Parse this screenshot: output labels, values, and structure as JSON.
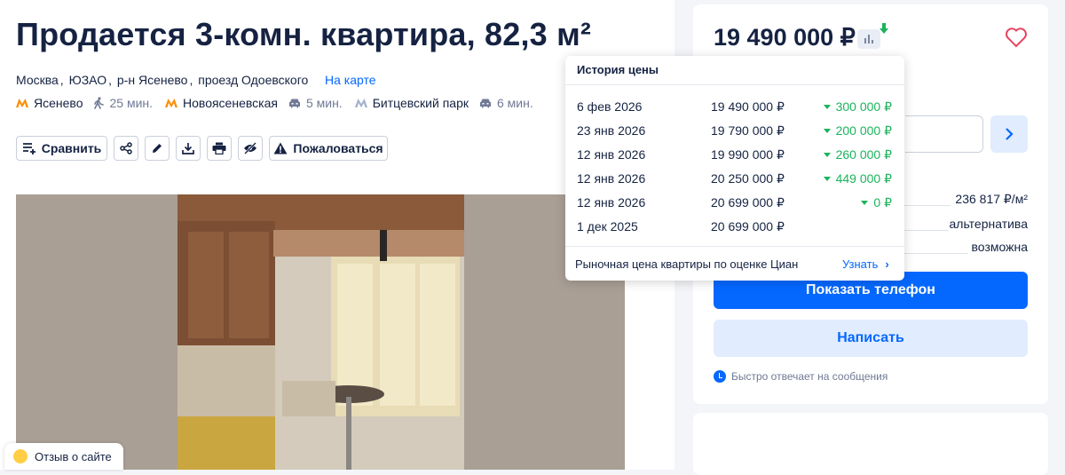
{
  "listing": {
    "title": "Продается 3-комн. квартира, 82,3 м²",
    "address": {
      "city": "Москва",
      "district": "ЮЗАО",
      "area": "р-н Ясенево",
      "street": "проезд Одоевского"
    },
    "map_link": "На карте",
    "metro": [
      {
        "name": "Ясенево",
        "time": "25 мин.",
        "mode": "walk-icon",
        "color": "#ff8c00"
      },
      {
        "name": "Новоясеневская",
        "time": "5 мин.",
        "mode": "car-icon",
        "color": "#ff8c00"
      },
      {
        "name": "Битцевский парк",
        "time": "6 мин.",
        "mode": "car-icon",
        "color": "#a3b0cc"
      }
    ],
    "actions": {
      "compare": "Сравнить",
      "complain": "Пожаловаться"
    }
  },
  "feedback": {
    "label": "Отзыв о сайте"
  },
  "sidebar": {
    "price": "19 490 000 ₽",
    "props": [
      {
        "value": "236 817 ₽/м²"
      },
      {
        "value": "альтернатива"
      },
      {
        "value": "возможна"
      }
    ],
    "phone_button": "Показать телефон",
    "write_button": "Написать",
    "fast_reply": "Быстро отвечает на сообщения"
  },
  "price_history": {
    "title": "История цены",
    "rows": [
      {
        "date": "6 фев 2026",
        "price": "19 490 000 ₽",
        "change": "300 000 ₽"
      },
      {
        "date": "23 янв 2026",
        "price": "19 790 000 ₽",
        "change": "200 000 ₽"
      },
      {
        "date": "12 янв 2026",
        "price": "19 990 000 ₽",
        "change": "260 000 ₽"
      },
      {
        "date": "12 янв 2026",
        "price": "20 250 000 ₽",
        "change": "449 000 ₽"
      },
      {
        "date": "12 янв 2026",
        "price": "20 699 000 ₽",
        "change": "0 ₽"
      },
      {
        "date": "1 дек 2025",
        "price": "20 699 000 ₽",
        "change": ""
      }
    ],
    "footer": "Рыночная цена квартиры по оценке Циан",
    "learn": "Узнать"
  },
  "colors": {
    "accent": "#0468ff",
    "price_drop": "#1bb35c",
    "text": "#152242",
    "muted": "#707a95"
  }
}
